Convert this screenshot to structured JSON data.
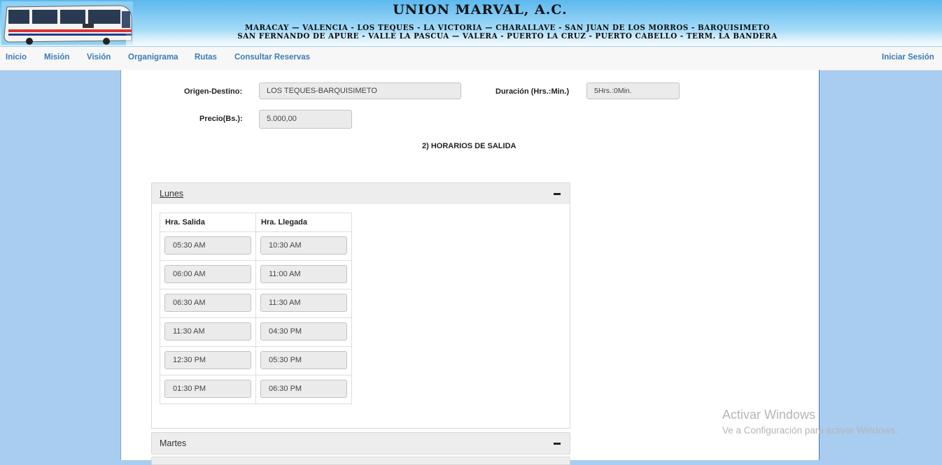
{
  "banner": {
    "title": "UNION MARVAL, A.C.",
    "routes_line1": "MARACAY — VALENCIA - LOS TEQUES - LA VICTORIA — CHARALLAVE - SAN JUAN DE LOS MORROS - BARQUISIMETO",
    "routes_line2": "SAN FERNANDO DE APURE - VALLE LA PASCUA — VALERA - PUERTO LA CRUZ - PUERTO CABELLO - TERM. LA BANDERA"
  },
  "nav": {
    "items": [
      "Inicio",
      "Misión",
      "Visión",
      "Organigrama",
      "Rutas",
      "Consultar Reservas"
    ],
    "login": "Iniciar Sesión"
  },
  "form": {
    "origin_label": "Origen-Destino:",
    "origin_value": "LOS TEQUES-BARQUISIMETO",
    "duration_label": "Duración (Hrs.:Min.)",
    "duration_value": "5Hrs.:0Min.",
    "price_label": "Precio(Bs.):",
    "price_value": "5.000,00"
  },
  "schedules": {
    "title": "2) HORARIOS DE SALIDA",
    "days": [
      {
        "name": "Lunes",
        "headers": [
          "Hra. Salida",
          "Hra. Llegada"
        ],
        "rows": [
          [
            "05:30 AM",
            "10:30 AM"
          ],
          [
            "06:00 AM",
            "11:00 AM"
          ],
          [
            "06:30 AM",
            "11:30 AM"
          ],
          [
            "11:30 AM",
            "04:30 PM"
          ],
          [
            "12:30 PM",
            "05:30 PM"
          ],
          [
            "01:30 PM",
            "06:30 PM"
          ]
        ]
      },
      {
        "name": "Martes"
      }
    ]
  },
  "watermark": {
    "line1": "Activar Windows",
    "line2": "Ve a Configuración para activar Windows."
  },
  "colors": {
    "page_bg": "#a9cdf0",
    "nav_link": "#3b7ab6",
    "field_bg": "#ebebeb"
  }
}
